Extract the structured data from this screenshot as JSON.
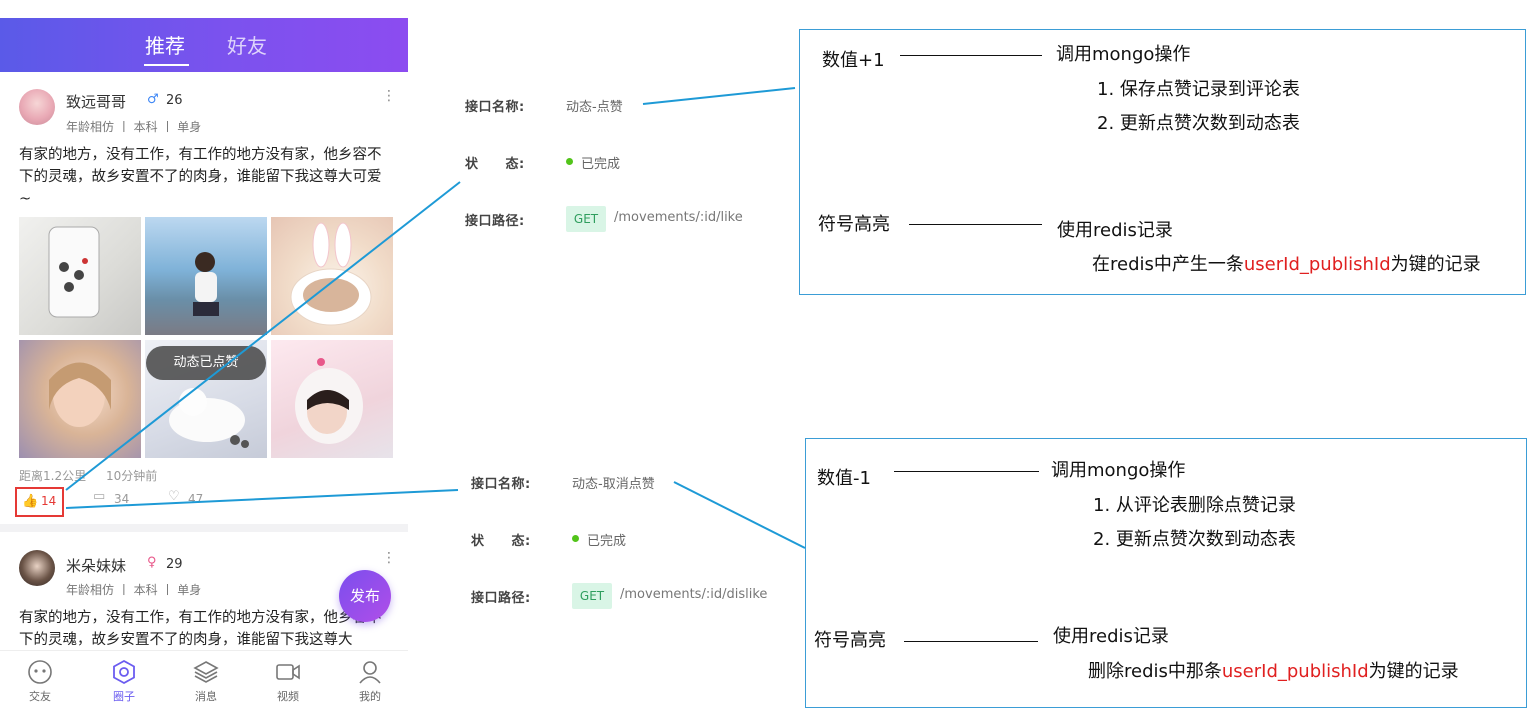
{
  "app": {
    "tabs": [
      {
        "label": "推荐",
        "active": true
      },
      {
        "label": "好友",
        "active": false
      }
    ],
    "posts": [
      {
        "username": "致远哥哥",
        "gender_icon": "male-icon",
        "age": "26",
        "meta": "年龄相仿 丨 本科 丨 单身",
        "text": "有家的地方，没有工作，有工作的地方没有家，他乡容不下的灵魂，故乡安置不了的肉身，谁能留下我这尊大可爱~",
        "distance": "距离1.2公里",
        "time_ago": "10分钟前",
        "likes": "14",
        "comments": "34",
        "loves": "47"
      },
      {
        "username": "米朵妹妹",
        "gender_icon": "female-icon",
        "age": "29",
        "meta": "年龄相仿 丨 本科 丨 单身",
        "text": "有家的地方，没有工作，有工作的地方没有家，他乡容不下的灵魂，故乡安置不了的肉身，谁能留下我这尊大"
      }
    ],
    "toast": "动态已点赞",
    "fab_label": "发布",
    "bottom_nav": [
      {
        "label": "交友",
        "icon": "chat-face-icon",
        "active": false
      },
      {
        "label": "圈子",
        "icon": "hexagon-icon",
        "active": true
      },
      {
        "label": "消息",
        "icon": "layers-icon",
        "active": false
      },
      {
        "label": "视频",
        "icon": "video-icon",
        "active": false
      },
      {
        "label": "我的",
        "icon": "user-icon",
        "active": false
      }
    ]
  },
  "api_like": {
    "name_label": "接口名称:",
    "name": "动态-点赞",
    "status_label": "状　　态:",
    "status": "已完成",
    "path_label": "接口路径:",
    "method": "GET",
    "path": "/movements/:id/like"
  },
  "api_dislike": {
    "name_label": "接口名称:",
    "name": "动态-取消点赞",
    "status_label": "状　　态:",
    "status": "已完成",
    "path_label": "接口路径:",
    "method": "GET",
    "path": "/movements/:id/dislike"
  },
  "note_like": {
    "count_label": "数值+1",
    "mongo_title": "调用mongo操作",
    "mongo_step1": "1. 保存点赞记录到评论表",
    "mongo_step2": "2. 更新点赞次数到动态表",
    "highlight_label": "符号高亮",
    "redis_title": "使用redis记录",
    "redis_prefix": "在redis中产生一条",
    "redis_key": "userId_publishId",
    "redis_suffix": "为键的记录"
  },
  "note_dislike": {
    "count_label": "数值-1",
    "mongo_title": "调用mongo操作",
    "mongo_step1": "1. 从评论表删除点赞记录",
    "mongo_step2": "2. 更新点赞次数到动态表",
    "highlight_label": "符号高亮",
    "redis_title": "使用redis记录",
    "redis_prefix": "删除redis中那条",
    "redis_key": "userId_publishId",
    "redis_suffix": "为键的记录"
  },
  "colors": {
    "accent_purple": "#7b52ee",
    "annotation_blue": "#3b9dd6",
    "like_red": "#e53935",
    "status_green": "#52c41a"
  }
}
